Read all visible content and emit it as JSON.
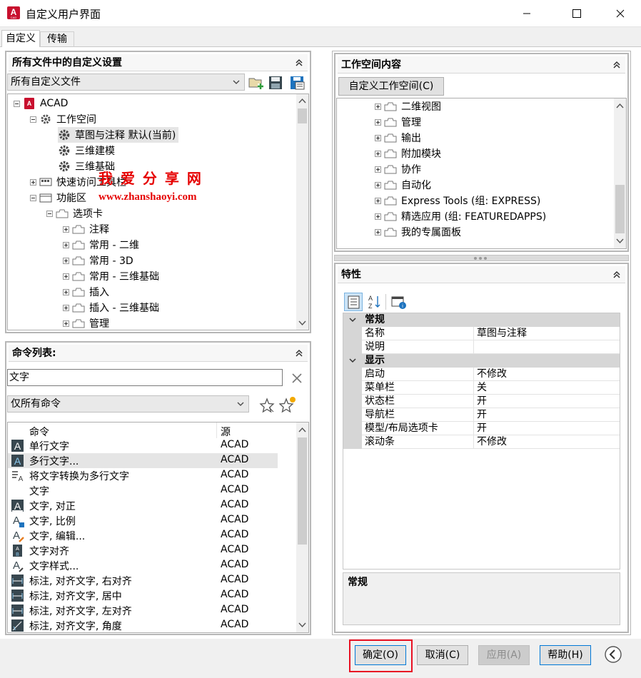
{
  "window": {
    "title": "自定义用户界面"
  },
  "tabs": [
    {
      "label": "自定义"
    },
    {
      "label": "传输"
    }
  ],
  "left_top": {
    "header": "所有文件中的自定义设置",
    "file_dropdown": "所有自定义文件",
    "tree": [
      {
        "label": "ACAD",
        "level": 0
      },
      {
        "label": "工作空间",
        "level": 1
      },
      {
        "label": "草图与注释 默认(当前)",
        "level": 2
      },
      {
        "label": "三维建模",
        "level": 2
      },
      {
        "label": "三维基础",
        "level": 2
      },
      {
        "label": "快速访问工具栏",
        "level": 1
      },
      {
        "label": "功能区",
        "level": 1
      },
      {
        "label": "选项卡",
        "level": 2
      },
      {
        "label": "注释",
        "level": 3
      },
      {
        "label": "常用 - 二维",
        "level": 3
      },
      {
        "label": "常用 - 3D",
        "level": 3
      },
      {
        "label": "常用 - 三维基础",
        "level": 3
      },
      {
        "label": "插入",
        "level": 3
      },
      {
        "label": "插入 - 三维基础",
        "level": 3
      },
      {
        "label": "管理",
        "level": 3
      }
    ]
  },
  "watermark": {
    "title": "我 爱 分 享 网",
    "url": "www.zhanshaoyi.com"
  },
  "left_bottom": {
    "header": "命令列表:",
    "search_value": "文字",
    "filter_dropdown": "仅所有命令",
    "columns": {
      "name": "命令",
      "source": "源"
    },
    "rows": [
      {
        "name": "单行文字",
        "source": "ACAD",
        "icon": "single-line-text-icon"
      },
      {
        "name": "多行文字...",
        "source": "ACAD",
        "icon": "multiline-text-icon"
      },
      {
        "name": "将文字转换为多行文字",
        "source": "ACAD",
        "icon": "convert-text-icon"
      },
      {
        "name": "文字",
        "source": "ACAD",
        "icon": ""
      },
      {
        "name": "文字, 对正",
        "source": "ACAD",
        "icon": "text-justify-icon"
      },
      {
        "name": "文字, 比例",
        "source": "ACAD",
        "icon": "text-scale-icon"
      },
      {
        "name": "文字, 编辑...",
        "source": "ACAD",
        "icon": "text-edit-icon"
      },
      {
        "name": "文字对齐",
        "source": "ACAD",
        "icon": "text-align-icon"
      },
      {
        "name": "文字样式...",
        "source": "ACAD",
        "icon": "text-style-icon"
      },
      {
        "name": "标注, 对齐文字, 右对齐",
        "source": "ACAD",
        "icon": "dim-right-icon"
      },
      {
        "name": "标注, 对齐文字, 居中",
        "source": "ACAD",
        "icon": "dim-center-icon"
      },
      {
        "name": "标注, 对齐文字, 左对齐",
        "source": "ACAD",
        "icon": "dim-left-icon"
      },
      {
        "name": "标注, 对齐文字, 角度",
        "source": "ACAD",
        "icon": "dim-angle-icon"
      }
    ]
  },
  "right_top": {
    "header": "工作空间内容",
    "customize_button": "自定义工作空间(C)",
    "items": [
      "二维视图",
      "管理",
      "输出",
      "附加模块",
      "协作",
      "自动化",
      "Express Tools (组: EXPRESS)",
      "精选应用 (组: FEATUREDAPPS)",
      "我的专属面板"
    ]
  },
  "right_bottom": {
    "header": "特性",
    "categories": [
      {
        "title": "常规",
        "props": [
          {
            "key": "名称",
            "value": "草图与注释"
          },
          {
            "key": "说明",
            "value": ""
          }
        ]
      },
      {
        "title": "显示",
        "props": [
          {
            "key": "启动",
            "value": "不修改"
          },
          {
            "key": "菜单栏",
            "value": "关"
          },
          {
            "key": "状态栏",
            "value": "开"
          },
          {
            "key": "导航栏",
            "value": "开"
          },
          {
            "key": "模型/布局选项卡",
            "value": "开"
          },
          {
            "key": "滚动条",
            "value": "不修改"
          }
        ]
      }
    ],
    "description_title": "常规"
  },
  "footer": {
    "ok": "确定(O)",
    "cancel": "取消(C)",
    "apply": "应用(A)",
    "help": "帮助(H)"
  },
  "colors": {
    "highlight_red": "#e81123",
    "watermark_red": "#e60000",
    "selected_row": "#e5e5e5",
    "accent_blue": "#0078d7"
  }
}
